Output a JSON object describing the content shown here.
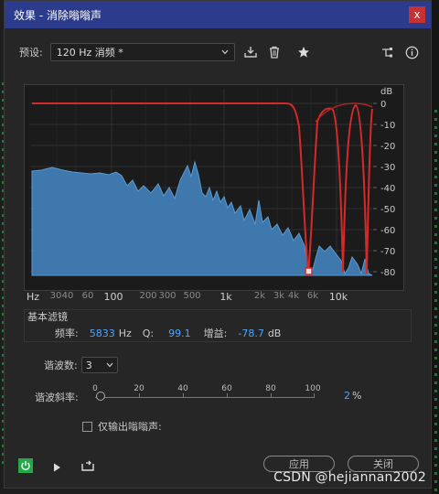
{
  "window": {
    "title": "效果 - 消除嗡嗡声",
    "close": "x"
  },
  "preset": {
    "label": "预设:",
    "value": "120 Hz 消频 *"
  },
  "icons": [
    "save-preset-icon",
    "trash-icon",
    "star-icon",
    "routing-icon",
    "info-icon"
  ],
  "graph": {
    "db_unit": "dB",
    "db_ticks": [
      "0",
      "-10",
      "-20",
      "-30",
      "-40",
      "-50",
      "-60",
      "-70",
      "-80"
    ],
    "x_ticks": [
      {
        "label": "Hz",
        "major": true
      },
      {
        "label": "30",
        "major": false
      },
      {
        "label": "40",
        "major": false
      },
      {
        "label": "60",
        "major": false
      },
      {
        "label": "100",
        "major": true
      },
      {
        "label": "200",
        "major": false
      },
      {
        "label": "300",
        "major": false
      },
      {
        "label": "500",
        "major": false
      },
      {
        "label": "1k",
        "major": true
      },
      {
        "label": "2k",
        "major": false
      },
      {
        "label": "3k",
        "major": false
      },
      {
        "label": "4k",
        "major": false
      },
      {
        "label": "6k",
        "major": false
      },
      {
        "label": "10k",
        "major": true
      }
    ],
    "colors": {
      "spectrum": "#4a86bd",
      "curve": "#d42a2a"
    }
  },
  "basic_filter": {
    "title": "基本滤镜",
    "freq_label": "频率:",
    "freq_value": "5833",
    "freq_unit": "Hz",
    "q_label": "Q:",
    "q_value": "99.1",
    "gain_label": "增益:",
    "gain_value": "-78.7",
    "gain_unit": "dB"
  },
  "harmonics": {
    "label": "谐波数:",
    "value": "3"
  },
  "slope": {
    "label": "谐波斜率:",
    "ticks": [
      "0",
      "20",
      "40",
      "60",
      "80",
      "100"
    ],
    "value": "2",
    "unit": "%",
    "level": 0.02
  },
  "only_output": {
    "label": "仅输出嗡嗡声:"
  },
  "footer": {
    "apply": "应用",
    "close": "关闭"
  },
  "watermark": "CSDN @hejiannan2002"
}
